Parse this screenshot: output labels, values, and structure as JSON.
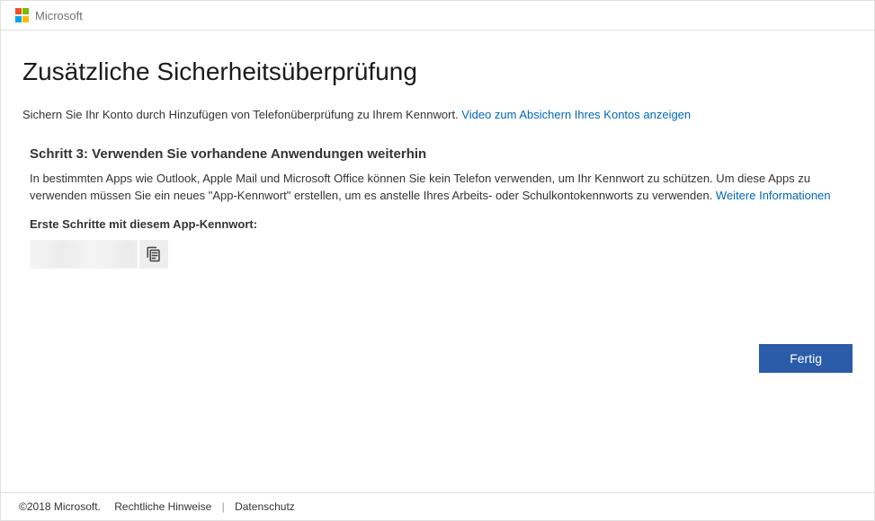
{
  "header": {
    "brand": "Microsoft"
  },
  "page": {
    "title": "Zusätzliche Sicherheitsüberprüfung",
    "intro": "Sichern Sie Ihr Konto durch Hinzufügen von Telefonüberprüfung zu Ihrem Kennwort. ",
    "intro_link": "Video zum Absichern Ihres Kontos anzeigen"
  },
  "step": {
    "title": "Schritt 3: Verwenden Sie vorhandene Anwendungen weiterhin",
    "desc_part1": "In bestimmten Apps wie Outlook, Apple Mail und Microsoft Office können Sie kein Telefon verwenden, um Ihr Kennwort zu schützen. Um diese Apps zu verwenden müssen Sie ein neues \"App-Kennwort\" erstellen, um es anstelle Ihres Arbeits- oder Schulkontokennworts zu verwenden. ",
    "desc_link": "Weitere Informationen",
    "pw_label": "Erste Schritte mit diesem App-Kennwort:"
  },
  "actions": {
    "done": "Fertig"
  },
  "footer": {
    "copyright": "©2018 Microsoft.",
    "legal": "Rechtliche Hinweise",
    "privacy": "Datenschutz"
  }
}
